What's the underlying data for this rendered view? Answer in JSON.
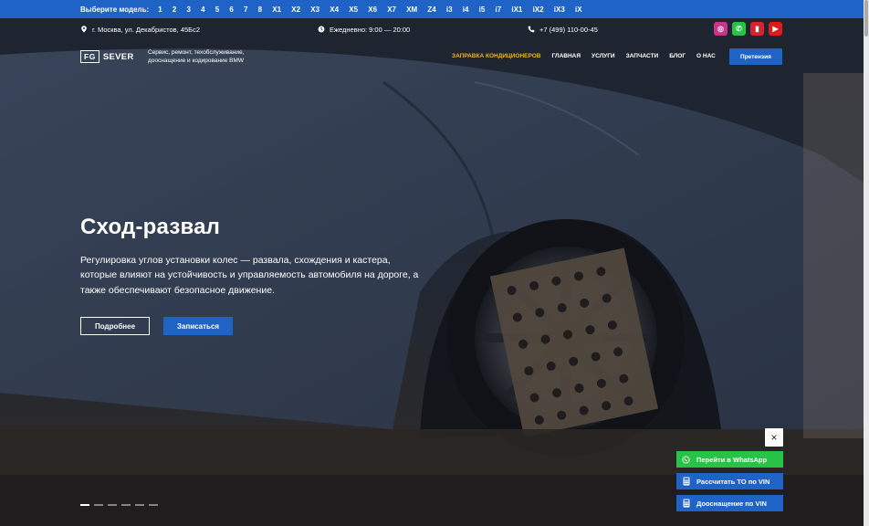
{
  "models": {
    "label": "Выберите модель:",
    "items": [
      "1",
      "2",
      "3",
      "4",
      "5",
      "6",
      "7",
      "8",
      "X1",
      "X2",
      "X3",
      "X4",
      "X5",
      "X6",
      "X7",
      "XM",
      "Z4",
      "i3",
      "i4",
      "i5",
      "i7",
      "iX1",
      "iX2",
      "iX3",
      "iX"
    ]
  },
  "info": {
    "address": "г. Москва, ул. Декабристов, 45Бс2",
    "hours": "Ежедневно: 9:00 — 20:00",
    "phone": "+7 (499) 110-00-45"
  },
  "socials": [
    {
      "name": "instagram-icon",
      "glyph": "◎",
      "color": "#c9338c"
    },
    {
      "name": "whatsapp-icon",
      "glyph": "✆",
      "color": "#27c346"
    },
    {
      "name": "telegram-icon",
      "glyph": "▮",
      "color": "#d6232f"
    },
    {
      "name": "youtube-icon",
      "glyph": "▶",
      "color": "#e0191b"
    }
  ],
  "header": {
    "logo_mark": "FG",
    "logo_text": "SEVER",
    "tagline": "Сервис, ремонт, техобслуживание, дооснащение и кодирование BMW",
    "nav": [
      {
        "label": "Заправка кондиционеров",
        "active": true
      },
      {
        "label": "Главная",
        "active": false
      },
      {
        "label": "Услуги",
        "active": false
      },
      {
        "label": "Запчасти",
        "active": false
      },
      {
        "label": "Блог",
        "active": false
      },
      {
        "label": "О нас",
        "active": false
      }
    ],
    "claim_button": "Претензия"
  },
  "hero": {
    "title": "Сход-развал",
    "description": "Регулировка углов установки колес — развала, схождения и кастера, которые влияют на устойчивость и управляемость автомобиля на дороге, а также обеспечивают безопасное движение.",
    "more_button": "Подробнее",
    "book_button": "Записаться",
    "slides_total": 6,
    "slide_active": 1
  },
  "floating": {
    "close": "×",
    "whatsapp": "Перейти в WhatsApp",
    "calc_to": "Рассчитать ТО по VIN",
    "retrofit": "Дооснащение по VIN"
  },
  "colors": {
    "brand_blue": "#1f63c6",
    "accent_yellow": "#f1b419",
    "whatsapp_green": "#27c346"
  }
}
